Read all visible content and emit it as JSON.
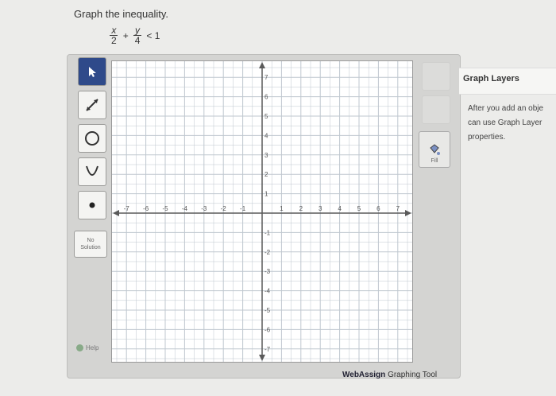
{
  "prompt": "Graph the inequality.",
  "inequality": {
    "x_num": "x",
    "x_den": "2",
    "plus": "+",
    "y_num": "y",
    "y_den": "4",
    "rel": "< 1"
  },
  "toolbar": {
    "tools": [
      "pointer-icon",
      "line-icon",
      "circle-icon",
      "parabola-icon",
      "point-icon"
    ],
    "no_solution_line1": "No",
    "no_solution_line2": "Solution",
    "help_label": "Help"
  },
  "fill_label": "Fill",
  "graph": {
    "x_ticks": [
      "-7",
      "-6",
      "-5",
      "-4",
      "-3",
      "-2",
      "-1",
      "1",
      "2",
      "3",
      "4",
      "5",
      "6",
      "7"
    ],
    "y_ticks": [
      "7",
      "6",
      "5",
      "4",
      "3",
      "2",
      "1",
      "-1",
      "-2",
      "-3",
      "-4",
      "-5",
      "-6",
      "-7"
    ],
    "axis_color": "#5a5a5a",
    "grid_color": "#bfc7cf"
  },
  "brand": {
    "part1": "WebAssign",
    "part2": "Graphing Tool"
  },
  "layers": {
    "title": "Graph Layers",
    "line1": "After you add an obje",
    "line2": "can use Graph Layer",
    "line3": "properties."
  }
}
